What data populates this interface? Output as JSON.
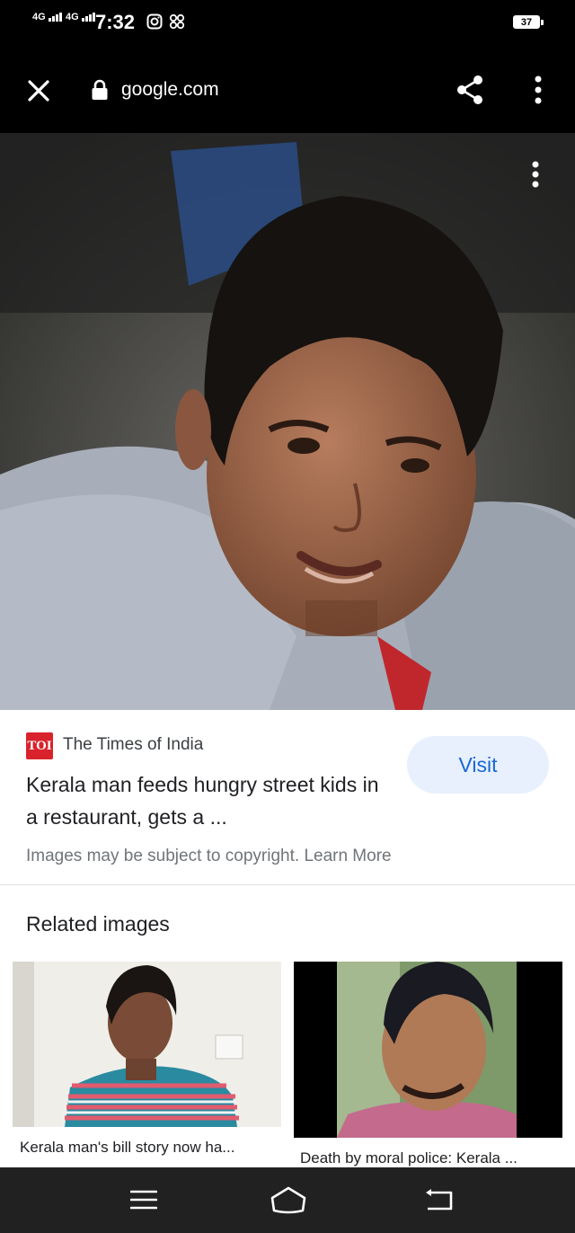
{
  "status_bar": {
    "network_1": "4G",
    "network_2": "4G",
    "time": "7:32",
    "battery": "37",
    "icons": [
      "signal-icon",
      "instagram-icon",
      "app-notification-icon",
      "battery-icon"
    ]
  },
  "url_bar": {
    "domain": "google.com",
    "icons": [
      "close-icon",
      "lock-icon",
      "share-icon",
      "more-vert-icon"
    ]
  },
  "image_viewer": {
    "more_icon": "more-vert-icon"
  },
  "result": {
    "source_logo": "TOI",
    "source_name": "The Times of India",
    "headline": "Kerala man feeds hungry street kids in a restaurant, gets a ...",
    "visit_label": "Visit",
    "copyright_text": "Images may be subject to copyright.",
    "learn_more": "Learn More",
    "source_color": "#d9232c",
    "accent_color": "#1967d2"
  },
  "related": {
    "title": "Related images",
    "items": [
      {
        "caption": "Kerala man's bill story now ha..."
      },
      {
        "caption": "Death by moral police: Kerala ..."
      }
    ]
  },
  "nav_bar": {
    "icons": [
      "menu-icon",
      "home-icon",
      "back-icon"
    ]
  }
}
